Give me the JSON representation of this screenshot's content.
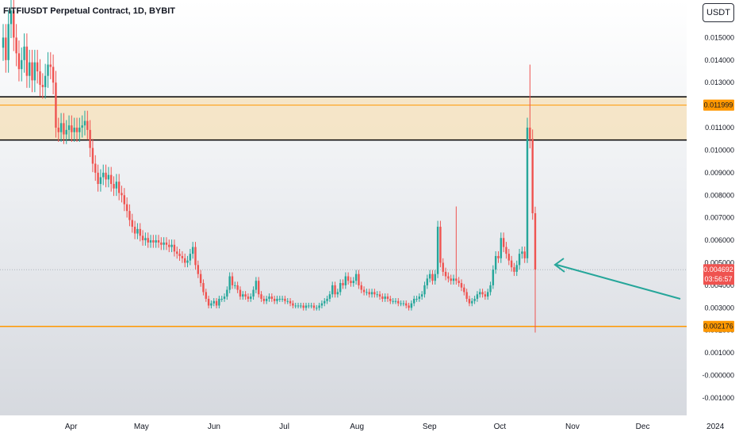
{
  "header": {
    "title": "FITFIUSDT Perpetual Contract, 1D, BYBIT",
    "currency_label": "USDT"
  },
  "price_labels": {
    "current_price": "0.004692",
    "countdown": "03:56:57",
    "resistance_price": "0.011999",
    "support_price": "0.002176"
  },
  "colors": {
    "up": "#26a69a",
    "down": "#ef5350",
    "zone_fill": "#f5deb3",
    "orange_line": "#ff9800",
    "black_line": "#000000",
    "arrow": "#26a69a"
  },
  "chart_data": {
    "type": "candlestick",
    "title": "FITFIUSDT Perpetual Contract, 1D, BYBIT",
    "ylim": [
      -0.0012,
      0.0164
    ],
    "y_ticks": [
      "0.015000",
      "0.014000",
      "0.013000",
      "0.012000",
      "0.011000",
      "0.010000",
      "0.009000",
      "0.008000",
      "0.007000",
      "0.006000",
      "0.005000",
      "0.004000",
      "0.003000",
      "0.002000",
      "0.001000",
      "-0.000000",
      "-0.001000"
    ],
    "x_ticks": [
      "Apr",
      "May",
      "Jun",
      "Jul",
      "Aug",
      "Sep",
      "Oct",
      "Nov",
      "Dec",
      "2024"
    ],
    "x_range": [
      "2023-03-03",
      "2024-01-19"
    ],
    "start_date": "2023-03-03",
    "series": [
      {
        "name": "price",
        "values": [
          0.015,
          0.014,
          0.0156,
          0.0162,
          0.015,
          0.0143,
          0.0136,
          0.014,
          0.0146,
          0.0133,
          0.0139,
          0.0131,
          0.0139,
          0.0135,
          0.0129,
          0.0128,
          0.0133,
          0.0138,
          0.0137,
          0.013,
          0.011,
          0.0108,
          0.0112,
          0.0107,
          0.0109,
          0.0111,
          0.0108,
          0.011,
          0.0108,
          0.011,
          0.0111,
          0.0113,
          0.0109,
          0.0101,
          0.0094,
          0.009,
          0.0085,
          0.0088,
          0.009,
          0.0087,
          0.0089,
          0.0085,
          0.0083,
          0.0086,
          0.0081,
          0.008,
          0.0076,
          0.0073,
          0.0069,
          0.0066,
          0.0063,
          0.0065,
          0.0062,
          0.006,
          0.0061,
          0.0059,
          0.006,
          0.0059,
          0.006,
          0.0059,
          0.0058,
          0.0059,
          0.0058,
          0.0057,
          0.0058,
          0.0055,
          0.0054,
          0.0053,
          0.0052,
          0.005,
          0.0051,
          0.0054,
          0.0057,
          0.0049,
          0.0045,
          0.0041,
          0.0037,
          0.0034,
          0.0031,
          0.0032,
          0.0033,
          0.0031,
          0.0034,
          0.0034,
          0.0035,
          0.0038,
          0.0044,
          0.004,
          0.004,
          0.0038,
          0.0035,
          0.0036,
          0.0035,
          0.0034,
          0.0035,
          0.0038,
          0.0042,
          0.0036,
          0.0034,
          0.0033,
          0.0034,
          0.0035,
          0.0034,
          0.0033,
          0.0034,
          0.0034,
          0.0034,
          0.0033,
          0.0033,
          0.0032,
          0.0031,
          0.0031,
          0.0031,
          0.0031,
          0.003,
          0.0031,
          0.0031,
          0.0031,
          0.003,
          0.003,
          0.0031,
          0.0032,
          0.0033,
          0.0034,
          0.0036,
          0.004,
          0.0036,
          0.0037,
          0.0041,
          0.004,
          0.0044,
          0.0042,
          0.0041,
          0.0042,
          0.0045,
          0.004,
          0.0038,
          0.0037,
          0.0037,
          0.0036,
          0.0037,
          0.0036,
          0.0036,
          0.0035,
          0.0034,
          0.0035,
          0.0034,
          0.0033,
          0.0033,
          0.0033,
          0.0032,
          0.0032,
          0.0032,
          0.0031,
          0.003,
          0.0032,
          0.0034,
          0.0034,
          0.0035,
          0.0036,
          0.004,
          0.0043,
          0.0045,
          0.0042,
          0.0045,
          0.0066,
          0.005,
          0.0046,
          0.0044,
          0.0043,
          0.0042,
          0.0043,
          0.0042,
          0.0041,
          0.0039,
          0.0037,
          0.0034,
          0.0032,
          0.0033,
          0.0034,
          0.0036,
          0.0037,
          0.0036,
          0.0035,
          0.0037,
          0.004,
          0.0047,
          0.0053,
          0.0052,
          0.0061,
          0.0057,
          0.0054,
          0.0051,
          0.0048,
          0.0046,
          0.0049,
          0.0054,
          0.0055,
          0.0052,
          0.011,
          0.0105,
          0.0072,
          0.0047
        ]
      },
      {
        "name": "support_line",
        "values": [
          0.002176
        ]
      },
      {
        "name": "zone_top",
        "values": [
          0.01237
        ]
      },
      {
        "name": "zone_bottom",
        "values": [
          0.01045
        ]
      },
      {
        "name": "zone_mid",
        "values": [
          0.011999
        ]
      }
    ]
  }
}
